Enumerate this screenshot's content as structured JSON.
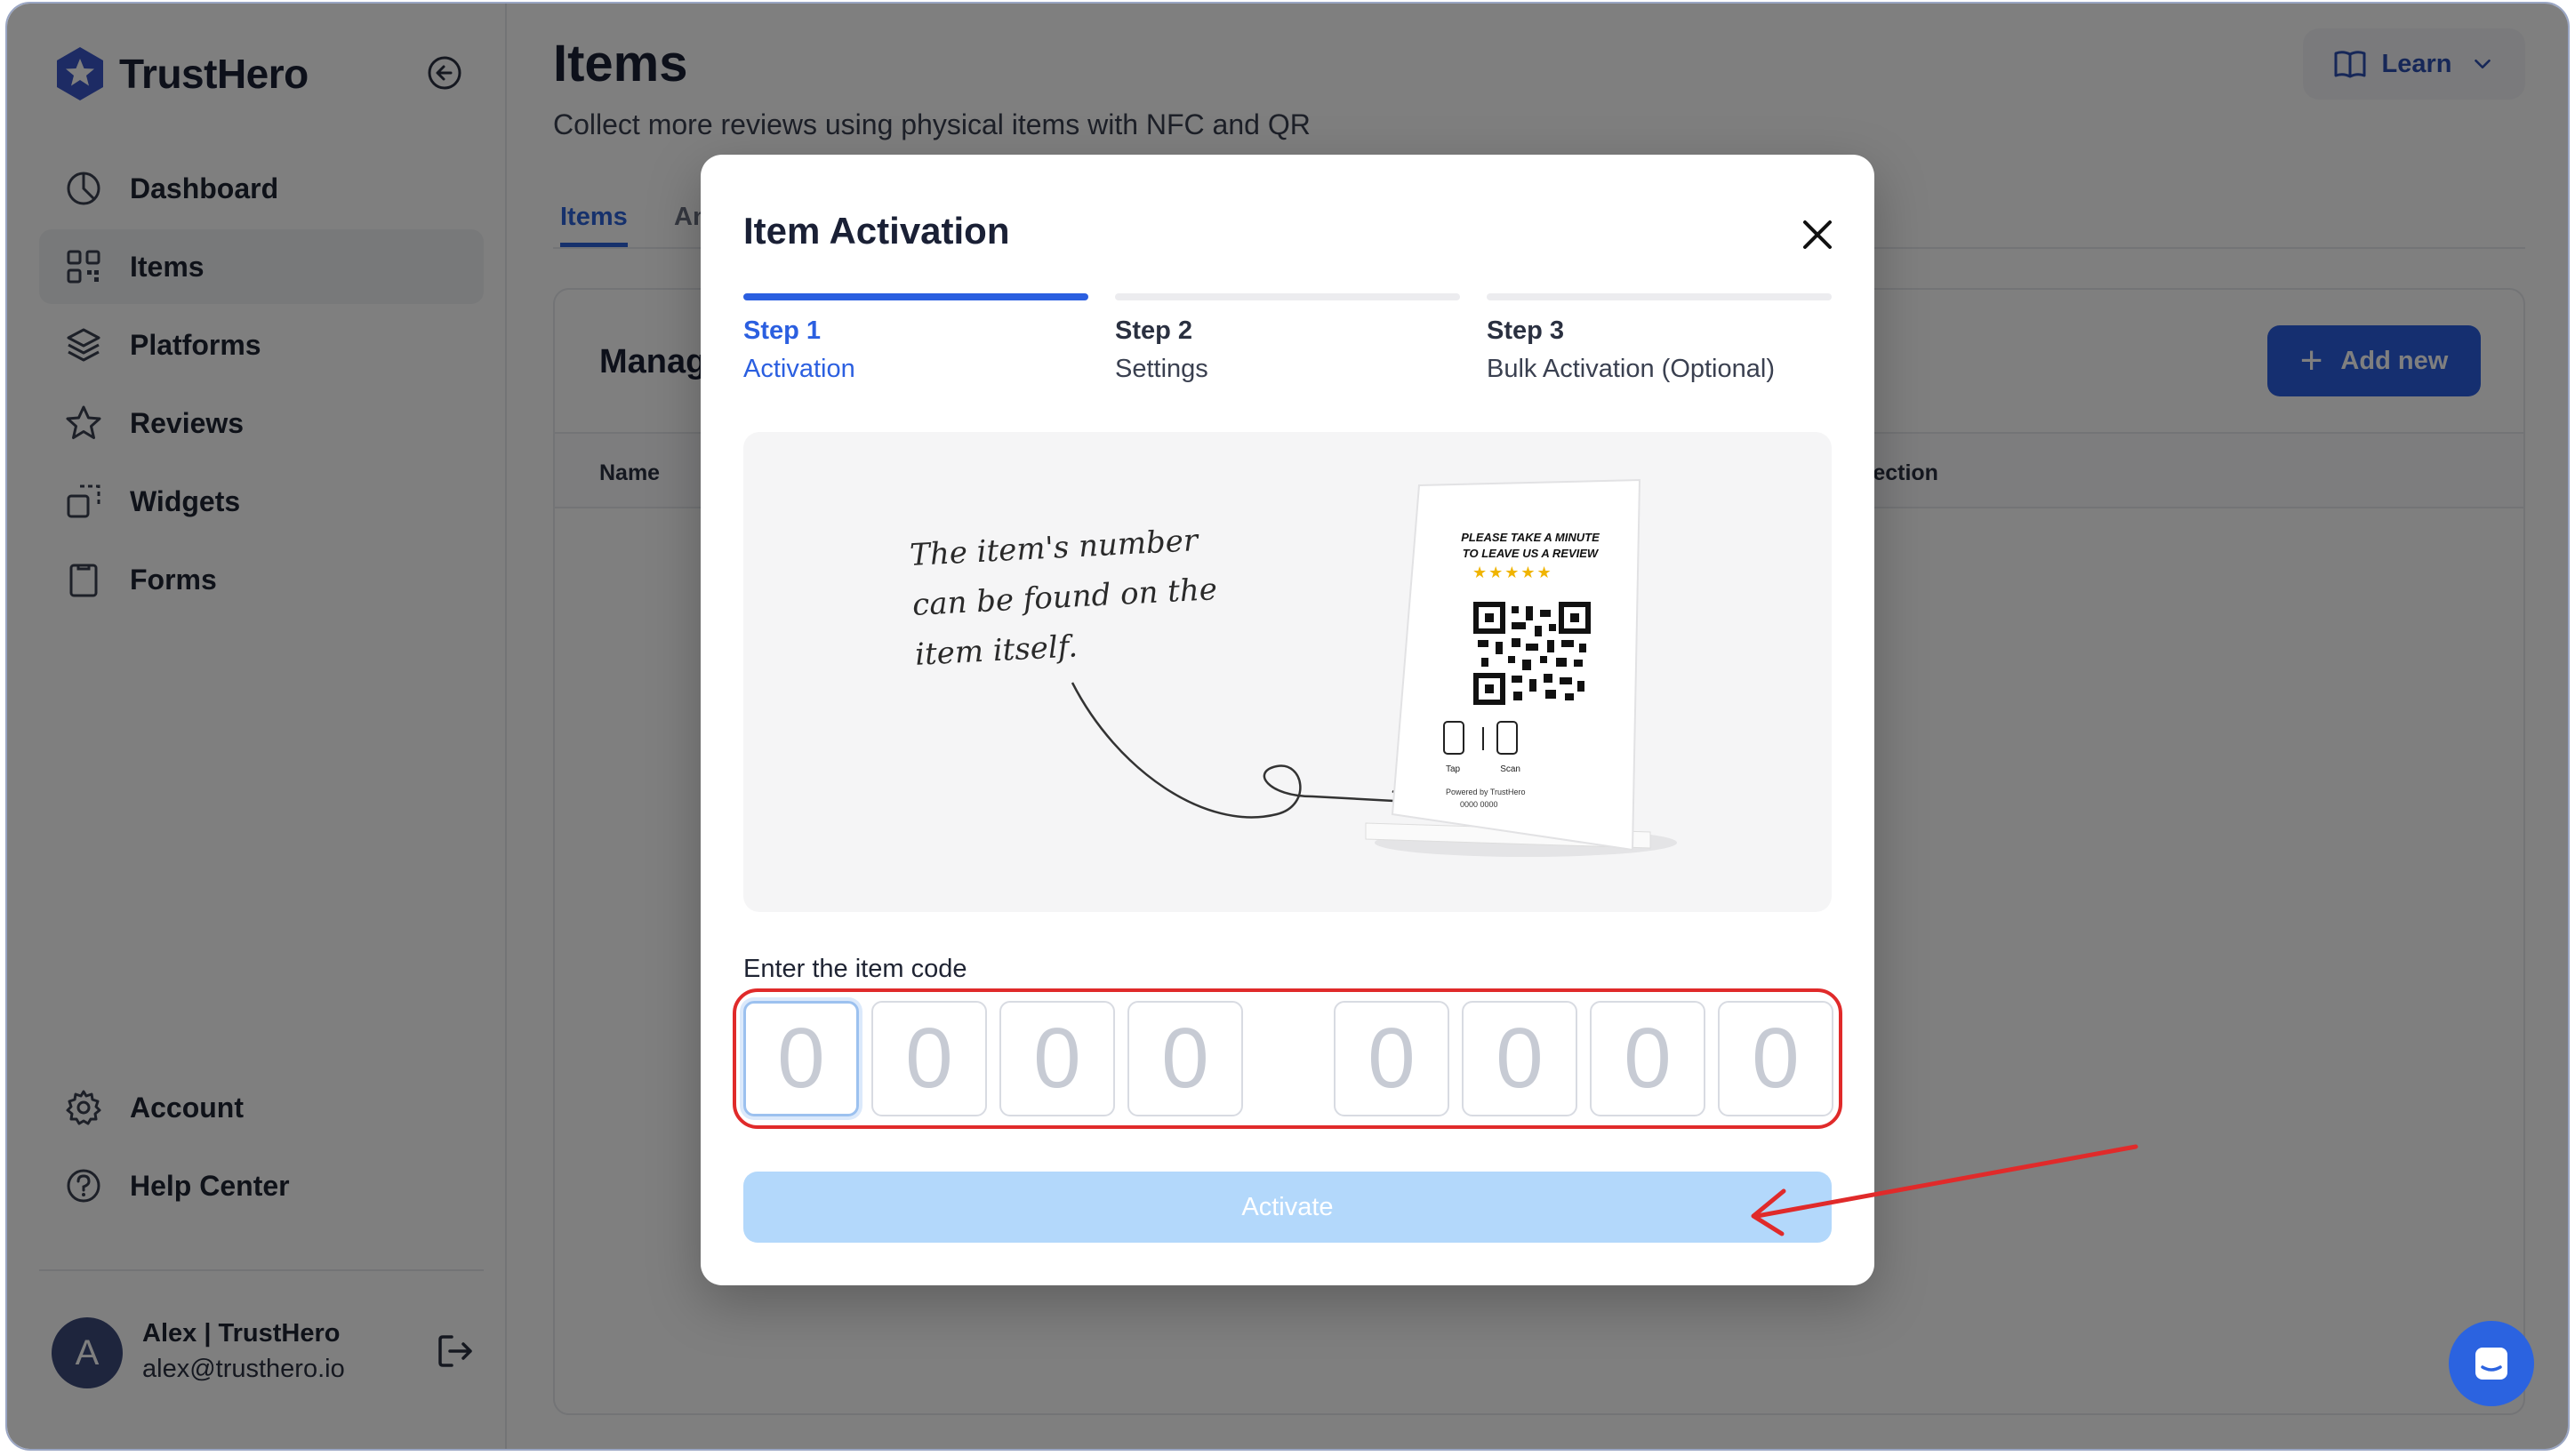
{
  "brand": {
    "name": "TrustHero"
  },
  "sidebar": {
    "items": [
      {
        "label": "Dashboard",
        "icon": "dashboard-icon"
      },
      {
        "label": "Items",
        "icon": "grid-icon",
        "active": true
      },
      {
        "label": "Platforms",
        "icon": "layers-icon"
      },
      {
        "label": "Reviews",
        "icon": "star-icon"
      },
      {
        "label": "Widgets",
        "icon": "widgets-icon"
      },
      {
        "label": "Forms",
        "icon": "clipboard-icon"
      }
    ],
    "bottom_items": [
      {
        "label": "Account",
        "icon": "gear-icon"
      },
      {
        "label": "Help Center",
        "icon": "help-icon"
      }
    ],
    "user": {
      "initial": "A",
      "name": "Alex | TrustHero",
      "email": "alex@trusthero.io"
    }
  },
  "header": {
    "title": "Items",
    "subtitle": "Collect more reviews using physical items with NFC and QR",
    "learn_label": "Learn"
  },
  "tabs": [
    {
      "label": "Items",
      "active": true
    },
    {
      "label": "An"
    }
  ],
  "panel": {
    "title": "Manag",
    "add_new_label": "Add new",
    "columns": [
      "Name",
      "tection"
    ]
  },
  "modal": {
    "title": "Item Activation",
    "steps": [
      {
        "num": "Step 1",
        "name": "Activation",
        "active": true
      },
      {
        "num": "Step 2",
        "name": "Settings"
      },
      {
        "num": "Step 3",
        "name": "Bulk Activation (Optional)"
      }
    ],
    "illustration": {
      "handwriting": [
        "The item's number",
        "can be found on the",
        "item itself."
      ],
      "stand_heading": [
        "PLEASE TAKE A MINUTE",
        "TO LEAVE US A REVIEW"
      ],
      "stand_tap": "Tap",
      "stand_scan": "Scan",
      "stand_powered": "Powered by TrustHero",
      "stand_code": "0000 0000"
    },
    "code_label": "Enter the item code",
    "code_digits": [
      "0",
      "0",
      "0",
      "0",
      "0",
      "0",
      "0",
      "0"
    ],
    "activate_label": "Activate"
  },
  "colors": {
    "accent": "#2b5fe0",
    "annotation": "#e02a2a",
    "button_disabled": "#b3d8fb"
  }
}
